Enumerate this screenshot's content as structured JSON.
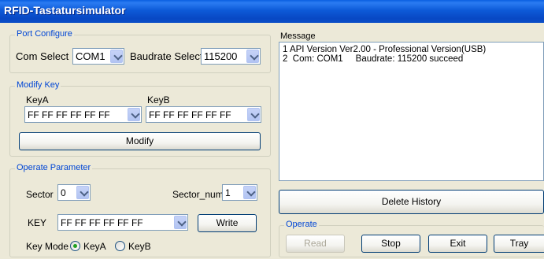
{
  "window": {
    "title": "RFID-Tastatursimulator"
  },
  "port_configure": {
    "legend": "Port Configure",
    "com_label": "Com Select",
    "com_value": "COM1",
    "baud_label": "Baudrate Select",
    "baud_value": "115200"
  },
  "modify_key": {
    "legend": "Modify Key",
    "keya_label": "KeyA",
    "keya_value": "FF FF FF FF FF FF",
    "keyb_label": "KeyB",
    "keyb_value": "FF FF FF FF FF FF",
    "modify_button": "Modify"
  },
  "operate_parameter": {
    "legend": "Operate Parameter",
    "sector_label": "Sector",
    "sector_value": "0",
    "sector_num_label": "Sector_num",
    "sector_num_value": "1",
    "key_label": "KEY",
    "key_value": "FF FF FF FF FF FF",
    "write_button": "Write",
    "key_mode_label": "Key Mode",
    "key_mode_options": [
      "KeyA",
      "KeyB"
    ],
    "key_mode_selected": "KeyA"
  },
  "message": {
    "label": "Message",
    "lines": [
      "1 API Version Ver2.00 - Professional Version(USB)",
      "2  Com: COM1     Baudrate: 115200 succeed"
    ],
    "delete_history_button": "Delete History"
  },
  "operate": {
    "legend": "Operate",
    "read_button": "Read",
    "stop_button": "Stop",
    "exit_button": "Exit",
    "tray_button": "Tray"
  }
}
